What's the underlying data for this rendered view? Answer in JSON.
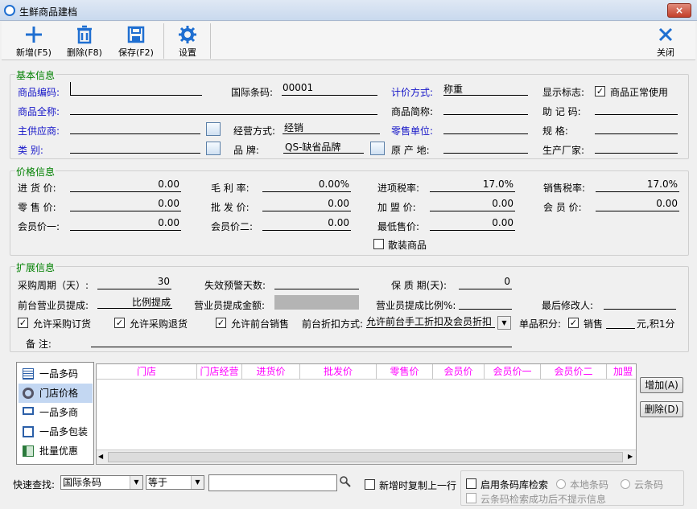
{
  "window": {
    "title": "生鲜商品建档",
    "close_symbol": "×"
  },
  "toolbar": {
    "new": "新增(F5)",
    "delete": "删除(F8)",
    "save": "保存(F2)",
    "settings": "设置",
    "close": "关闭"
  },
  "basic": {
    "title": "基本信息",
    "code_label": "商品编码:",
    "barcode_label": "国际条码:",
    "barcode_value": "00001",
    "pricing_label": "计价方式:",
    "pricing_value": "称重",
    "display_label": "显示标志:",
    "display_check": "商品正常使用",
    "fullname_label": "商品全称:",
    "shortname_label": "商品简称:",
    "mnemonic_label": "助 记 码:",
    "supplier_label": "主供应商:",
    "mode_label": "经营方式:",
    "mode_value": "经销",
    "unit_label": "零售单位:",
    "spec_label": "规    格:",
    "category_label": "类    别:",
    "brand_label": "品    牌:",
    "brand_value": "QS-缺省品牌",
    "origin_label": "原 产 地:",
    "maker_label": "生产厂家:"
  },
  "price": {
    "title": "价格信息",
    "purchase_label": "进 货 价:",
    "purchase_value": "0.00",
    "margin_label": "毛 利 率:",
    "margin_value": "0.00%",
    "intax_label": "进项税率:",
    "intax_value": "17.0%",
    "outtax_label": "销售税率:",
    "outtax_value": "17.0%",
    "retail_label": "零 售 价:",
    "retail_value": "0.00",
    "wholesale_label": "批 发 价:",
    "wholesale_value": "0.00",
    "franchise_label": "加 盟 价:",
    "franchise_value": "0.00",
    "member_label": "会 员 价:",
    "member_value": "0.00",
    "member1_label": "会员价一:",
    "member1_value": "0.00",
    "member2_label": "会员价二:",
    "member2_value": "0.00",
    "lowest_label": "最低售价:",
    "lowest_value": "0.00",
    "bulk_label": "散装商品"
  },
  "ext": {
    "title": "扩展信息",
    "cycle_label": "采购周期（天）:",
    "cycle_value": "30",
    "expire_warn_label": "失效预警天数:",
    "shelf_label": "保 质 期(天):",
    "shelf_value": "0",
    "front_comm_label": "前台营业员提成:",
    "front_comm_value": "比例提成",
    "amount_label": "营业员提成金额:",
    "ratio_label": "营业员提成比例%:",
    "modifier_label": "最后修改人:",
    "allow_order": "允许采购订货",
    "allow_return": "允许采购退货",
    "allow_sale": "允许前台销售",
    "discount_label": "前台折扣方式:",
    "discount_value": "允许前台手工折扣及会员折扣",
    "points_label": "单品积分:",
    "points_check": "销售",
    "points_suffix": "元,积1分",
    "remark_label": "备      注:"
  },
  "side": {
    "items": [
      "一品多码",
      "门店价格",
      "一品多商",
      "一品多包装",
      "批量优惠"
    ]
  },
  "grid": {
    "headers": [
      "门店",
      "门店经营",
      "进货价",
      "批发价",
      "零售价",
      "会员价",
      "会员价一",
      "会员价二",
      "加盟"
    ]
  },
  "buttons": {
    "add": "增加(A)",
    "remove": "删除(D)"
  },
  "bottom": {
    "quick_label": "快速查找:",
    "field_value": "国际条码",
    "op_value": "等于",
    "copy_label": "新增时复制上一行",
    "barcode_lib": "启用条码库检索",
    "local": "本地条码",
    "cloud": "云条码",
    "no_tip": "云条码检索成功后不提示信息"
  },
  "colors": {
    "accent": "#1f6fd1",
    "label_blue": "#1414c8",
    "group_green": "#008000",
    "header_magenta": "#ff00ff"
  }
}
